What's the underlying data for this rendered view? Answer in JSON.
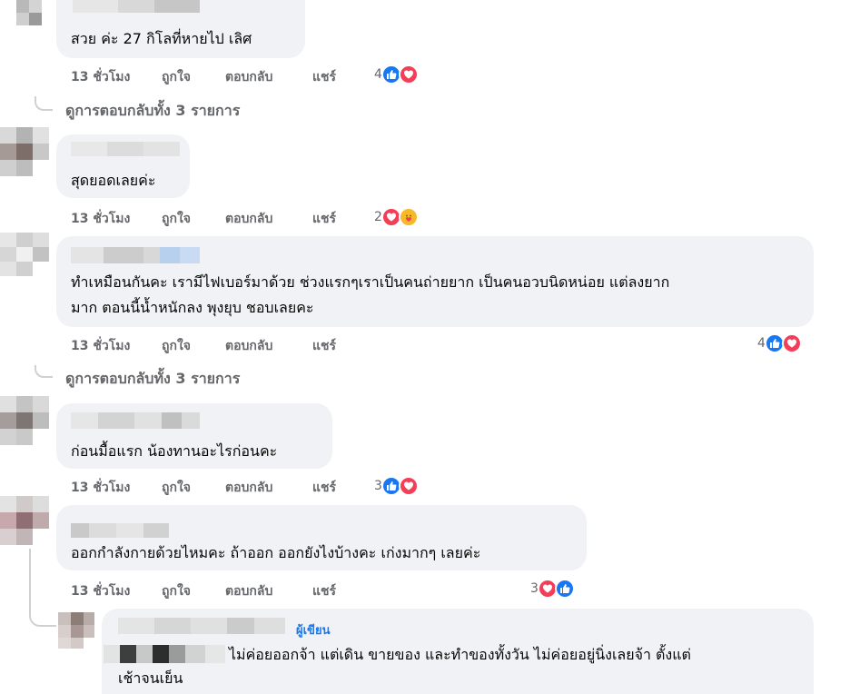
{
  "comments": [
    {
      "text": "สวย ค่ะ 27 กิโลที่หายไป เลิศ",
      "time": "13 ชั่วโมง",
      "like": "ถูกใจ",
      "reply": "ตอบกลับ",
      "share": "แชร์",
      "reaction_count": "4",
      "reactions": [
        "like-icon",
        "love-icon"
      ]
    },
    {
      "text": "สุดยอดเลยค่ะ",
      "time": "13 ชั่วโมง",
      "like": "ถูกใจ",
      "reply": "ตอบกลับ",
      "share": "แชร์",
      "reaction_count": "2",
      "reactions": [
        "love-icon",
        "care-icon"
      ]
    },
    {
      "text_line1": "ทำเหมือนกันคะ เรามีไฟเบอร์มาด้วย ช่วงแรกๆเราเป็นคนถ่ายยาก เป็นคนอวบนิดหน่อย แต่ลงยาก",
      "text_line2": "มาก ตอนนี้น้ำหนักลง พุงยุบ ชอบเลยคะ",
      "time": "13 ชั่วโมง",
      "like": "ถูกใจ",
      "reply": "ตอบกลับ",
      "share": "แชร์",
      "reaction_count": "4",
      "reactions": [
        "like-icon",
        "love-icon"
      ]
    },
    {
      "text": "ก่อนมื้อแรก น้องทานอะไรก่อนคะ",
      "time": "13 ชั่วโมง",
      "like": "ถูกใจ",
      "reply": "ตอบกลับ",
      "share": "แชร์",
      "reaction_count": "3",
      "reactions": [
        "like-icon",
        "love-icon"
      ]
    },
    {
      "text": "ออกกำลังกายด้วยไหมคะ ถ้าออก ออกยังไงบ้างคะ เก่งมากๆ เลยค่ะ",
      "time": "13 ชั่วโมง",
      "like": "ถูกใจ",
      "reply": "ตอบกลับ",
      "share": "แชร์",
      "reaction_count": "3",
      "reactions": [
        "love-icon",
        "like-icon"
      ]
    }
  ],
  "view_replies": [
    "ดูการตอบกลับทั้ง 3 รายการ",
    "ดูการตอบกลับทั้ง 3 รายการ"
  ],
  "author_reply": {
    "badge": "ผู้เขียน",
    "text_line1": "ไม่ค่อยออกจ้า แต่เดิน ขายของ และทำของทั้งวัน ไม่ค่อยอยู่นิ่งเลยจ้า ตั้งแต่",
    "text_line2": "เช้าจนเย็น"
  },
  "colors": {
    "bubble": "#f0f2f5",
    "meta": "#65676b",
    "like": "#1877f2",
    "love": "#f33e58",
    "care": "#f7b928"
  }
}
